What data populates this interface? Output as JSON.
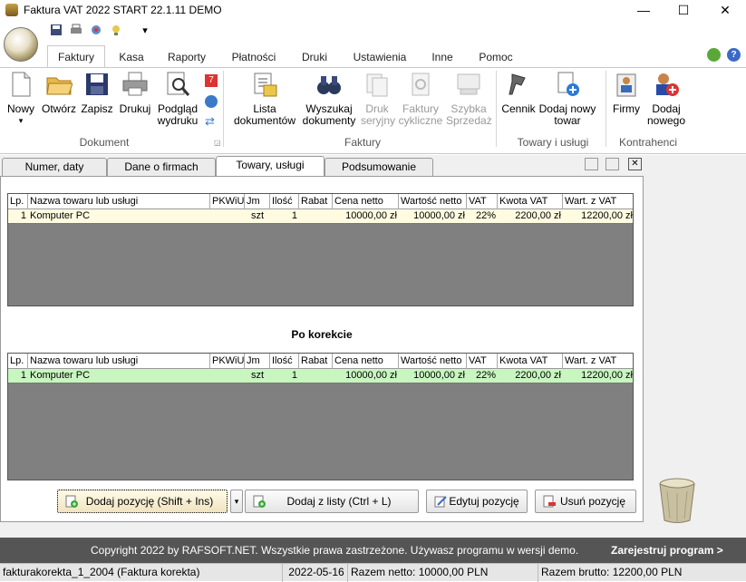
{
  "window": {
    "title": "Faktura VAT 2022 START 22.1.11 DEMO",
    "minimize": "—",
    "maximize": "☐",
    "close": "✕"
  },
  "qat": {
    "dropdown": "▾"
  },
  "ribbon_tabs": [
    "Faktury",
    "Kasa",
    "Raporty",
    "Płatności",
    "Druki",
    "Ustawienia",
    "Inne",
    "Pomoc"
  ],
  "ribbon": {
    "nowy": "Nowy",
    "nowy_arrow": "▾",
    "otworz": "Otwórz",
    "zapisz": "Zapisz",
    "drukuj": "Drukuj",
    "podglad": "Podgląd\nwydruku",
    "group_dokument": "Dokument",
    "lista": "Lista\ndokumentów",
    "wyszukaj": "Wyszukaj\ndokumenty",
    "druk_seryjny": "Druk\nseryjny",
    "faktury_cykliczne": "Faktury\ncykliczne",
    "szybka_sprzedaz": "Szybka\nSprzedaż",
    "group_faktury": "Faktury",
    "cennik": "Cennik",
    "dodaj_towar": "Dodaj nowy\ntowar",
    "group_towary": "Towary i usługi",
    "firmy": "Firmy",
    "dodaj_nowego": "Dodaj\nnowego",
    "group_kontrahenci": "Kontrahenci"
  },
  "doc_tabs": [
    "Numer, daty",
    "Dane o firmach",
    "Towary, usługi",
    "Podsumowanie"
  ],
  "columns": [
    "Lp.",
    "Nazwa towaru lub usługi",
    "PKWiU",
    "Jm",
    "Ilość",
    "Rabat",
    "Cena netto",
    "Wartość netto",
    "VAT",
    "Kwota VAT",
    "Wart. z VAT"
  ],
  "before_rows": [
    {
      "lp": "1",
      "nazwa": "Komputer PC",
      "pkwiu": "",
      "jm": "szt",
      "ilosc": "1",
      "rabat": "",
      "cena": "10000,00 zł",
      "wartosc": "10000,00 zł",
      "vat": "22%",
      "kwota": "2200,00 zł",
      "wart_vat": "12200,00 zł"
    }
  ],
  "after_title": "Po korekcie",
  "after_rows": [
    {
      "lp": "1",
      "nazwa": "Komputer PC",
      "pkwiu": "",
      "jm": "szt",
      "ilosc": "1",
      "rabat": "",
      "cena": "10000,00 zł",
      "wartosc": "10000,00 zł",
      "vat": "22%",
      "kwota": "2200,00 zł",
      "wart_vat": "12200,00 zł"
    }
  ],
  "buttons": {
    "dodaj_pozycje": "Dodaj pozycję (Shift + Ins)",
    "dodaj_z_listy": "Dodaj z listy (Ctrl + L)",
    "edytuj": "Edytuj pozycję",
    "usun": "Usuń pozycję"
  },
  "footer": {
    "copyright": "Copyright 2022 by RAFSOFT.NET. Wszystkie prawa zastrzeżone. Używasz programu w wersji demo.",
    "register": "Zarejestruj program >"
  },
  "status": {
    "file": "fakturakorekta_1_2004 (Faktura korekta)",
    "date": "2022-05-16",
    "netto": "Razem netto: 10000,00 PLN",
    "brutto": "Razem brutto: 12200,00 PLN"
  },
  "colors": {
    "row_before": "#fffbe0",
    "row_after": "#c8f5c0",
    "grid_bg": "#808080",
    "footer_bg": "#555555"
  }
}
